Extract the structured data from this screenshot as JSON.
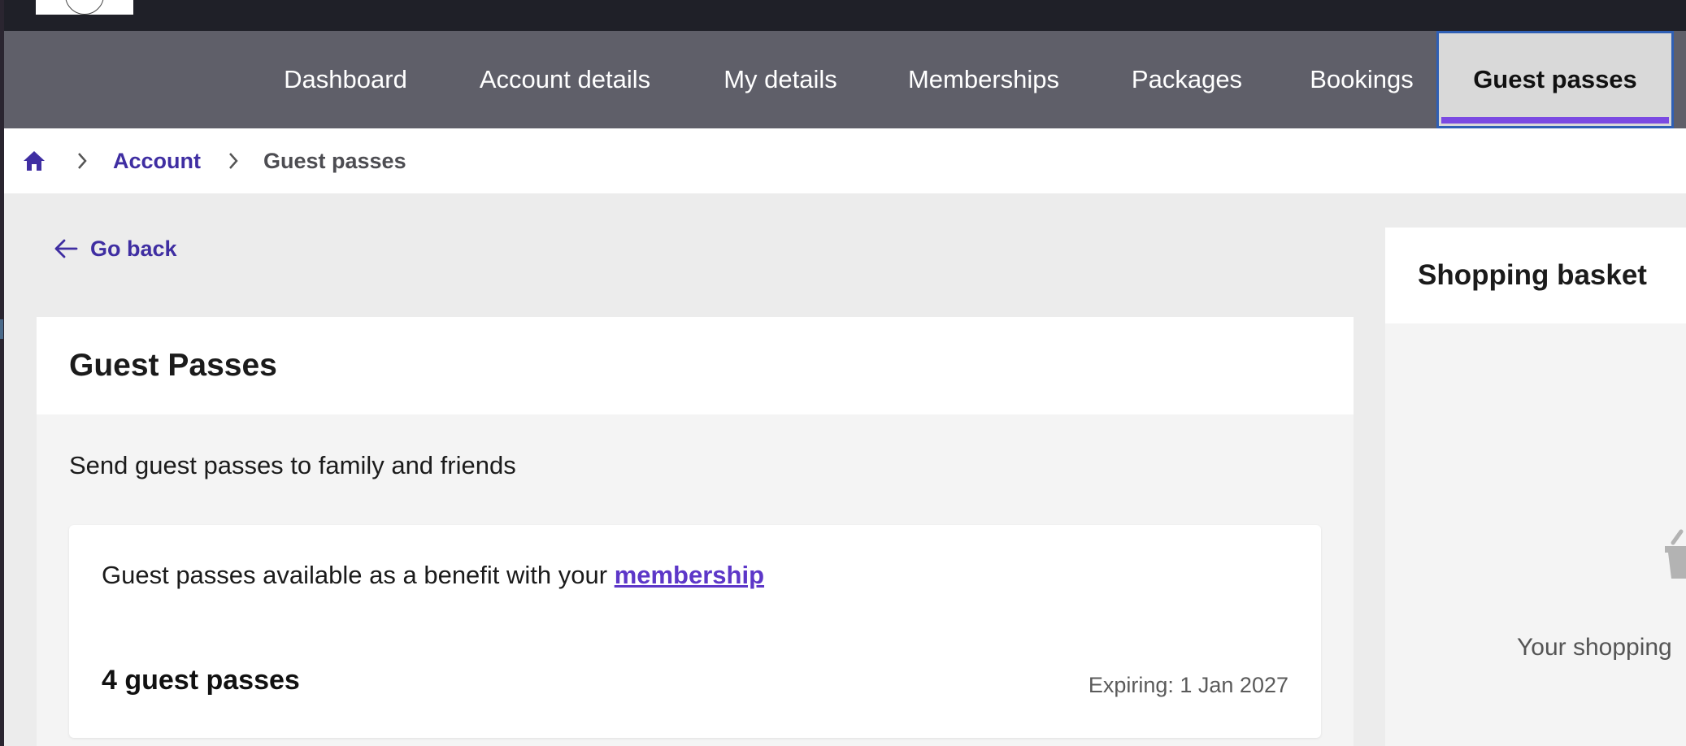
{
  "nav": {
    "items": [
      {
        "label": "Dashboard"
      },
      {
        "label": "Account details"
      },
      {
        "label": "My details"
      },
      {
        "label": "Memberships"
      },
      {
        "label": "Packages"
      },
      {
        "label": "Bookings"
      },
      {
        "label": "Guest passes",
        "active": true
      }
    ]
  },
  "breadcrumb": {
    "home_icon": "home-icon",
    "items": [
      {
        "label": "Account"
      },
      {
        "label": "Guest passes"
      }
    ]
  },
  "go_back": {
    "label": "Go back",
    "icon": "arrow-left-icon"
  },
  "guest_passes": {
    "title": "Guest Passes",
    "subtitle": "Send guest passes to family and friends",
    "benefit_text": "Guest passes available as a benefit with your ",
    "benefit_link": "membership",
    "count": "4 guest passes",
    "expiry": "Expiring: 1 Jan 2027"
  },
  "basket": {
    "title": "Shopping basket",
    "empty_text": "Your shopping",
    "icon": "basket-icon"
  },
  "colors": {
    "nav_bg": "#5f5f69",
    "accent": "#7b4ae2",
    "link": "#3f2ea2",
    "active_tab_bg": "#d9d9d9"
  }
}
